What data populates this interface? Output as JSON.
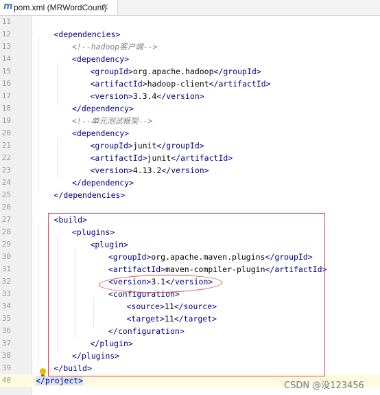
{
  "tab": {
    "icon": "m",
    "label": "pom.xml (MRWordCount)",
    "close": "×"
  },
  "lines": [
    {
      "n": "11",
      "indent": 0,
      "parts": []
    },
    {
      "n": "12",
      "indent": 1,
      "parts": [
        {
          "t": "tg",
          "v": "<dependencies>"
        }
      ]
    },
    {
      "n": "13",
      "indent": 2,
      "parts": [
        {
          "t": "cm",
          "v": "<!--hadoop客户端-->"
        }
      ]
    },
    {
      "n": "14",
      "indent": 2,
      "parts": [
        {
          "t": "tg",
          "v": "<dependency>"
        }
      ]
    },
    {
      "n": "15",
      "indent": 3,
      "parts": [
        {
          "t": "tg",
          "v": "<groupId>"
        },
        {
          "t": "tx",
          "v": "org.apache.hadoop"
        },
        {
          "t": "tg",
          "v": "</groupId>"
        }
      ]
    },
    {
      "n": "16",
      "indent": 3,
      "parts": [
        {
          "t": "tg",
          "v": "<artifactId>"
        },
        {
          "t": "tx",
          "v": "hadoop-client"
        },
        {
          "t": "tg",
          "v": "</artifactId>"
        }
      ]
    },
    {
      "n": "17",
      "indent": 3,
      "parts": [
        {
          "t": "tg",
          "v": "<version>"
        },
        {
          "t": "tx",
          "v": "3.3.4"
        },
        {
          "t": "tg",
          "v": "</version>"
        }
      ]
    },
    {
      "n": "18",
      "indent": 2,
      "parts": [
        {
          "t": "tg",
          "v": "</dependency>"
        }
      ]
    },
    {
      "n": "19",
      "indent": 2,
      "parts": [
        {
          "t": "cm",
          "v": "<!--单元测试框架-->"
        }
      ]
    },
    {
      "n": "20",
      "indent": 2,
      "parts": [
        {
          "t": "tg",
          "v": "<dependency>"
        }
      ]
    },
    {
      "n": "21",
      "indent": 3,
      "parts": [
        {
          "t": "tg",
          "v": "<groupId>"
        },
        {
          "t": "tx",
          "v": "junit"
        },
        {
          "t": "tg",
          "v": "</groupId>"
        }
      ]
    },
    {
      "n": "22",
      "indent": 3,
      "parts": [
        {
          "t": "tg",
          "v": "<artifactId>"
        },
        {
          "t": "tx",
          "v": "junit"
        },
        {
          "t": "tg",
          "v": "</artifactId>"
        }
      ]
    },
    {
      "n": "23",
      "indent": 3,
      "parts": [
        {
          "t": "tg",
          "v": "<version>"
        },
        {
          "t": "tx",
          "v": "4.13.2"
        },
        {
          "t": "tg",
          "v": "</version>"
        }
      ]
    },
    {
      "n": "24",
      "indent": 2,
      "parts": [
        {
          "t": "tg",
          "v": "</dependency>"
        }
      ]
    },
    {
      "n": "25",
      "indent": 1,
      "parts": [
        {
          "t": "tg",
          "v": "</dependencies>"
        }
      ]
    },
    {
      "n": "26",
      "indent": 0,
      "parts": []
    },
    {
      "n": "27",
      "indent": 1,
      "parts": [
        {
          "t": "tg",
          "v": "<build>"
        }
      ]
    },
    {
      "n": "28",
      "indent": 2,
      "parts": [
        {
          "t": "tg",
          "v": "<plugins>"
        }
      ]
    },
    {
      "n": "29",
      "indent": 3,
      "parts": [
        {
          "t": "tg",
          "v": "<plugin>"
        }
      ]
    },
    {
      "n": "30",
      "indent": 4,
      "parts": [
        {
          "t": "tg",
          "v": "<groupId>"
        },
        {
          "t": "tx",
          "v": "org.apache.maven.plugins"
        },
        {
          "t": "tg",
          "v": "</groupId>"
        }
      ]
    },
    {
      "n": "31",
      "indent": 4,
      "parts": [
        {
          "t": "tg",
          "v": "<artifactId>"
        },
        {
          "t": "tx",
          "v": "maven-compiler-plugin"
        },
        {
          "t": "tg",
          "v": "</artifactId>"
        }
      ]
    },
    {
      "n": "32",
      "indent": 4,
      "parts": [
        {
          "t": "tg",
          "v": "<version>"
        },
        {
          "t": "tx",
          "v": "3.1"
        },
        {
          "t": "tg",
          "v": "</version>"
        }
      ]
    },
    {
      "n": "33",
      "indent": 4,
      "parts": [
        {
          "t": "tg",
          "v": "<configuration>"
        }
      ]
    },
    {
      "n": "34",
      "indent": 5,
      "parts": [
        {
          "t": "tg",
          "v": "<source>"
        },
        {
          "t": "tx",
          "v": "11"
        },
        {
          "t": "tg",
          "v": "</source>"
        }
      ]
    },
    {
      "n": "35",
      "indent": 5,
      "parts": [
        {
          "t": "tg",
          "v": "<target>"
        },
        {
          "t": "tx",
          "v": "11"
        },
        {
          "t": "tg",
          "v": "</target>"
        }
      ]
    },
    {
      "n": "36",
      "indent": 4,
      "parts": [
        {
          "t": "tg",
          "v": "</configuration>"
        }
      ]
    },
    {
      "n": "37",
      "indent": 3,
      "parts": [
        {
          "t": "tg",
          "v": "</plugin>"
        }
      ]
    },
    {
      "n": "38",
      "indent": 2,
      "parts": [
        {
          "t": "tg",
          "v": "</plugins>"
        }
      ]
    },
    {
      "n": "39",
      "indent": 1,
      "parts": [
        {
          "t": "tg",
          "v": "</build>"
        }
      ]
    },
    {
      "n": "40",
      "indent": 0,
      "parts": [
        {
          "t": "tg cursor-tag",
          "v": "</project>"
        }
      ]
    }
  ],
  "watermark": "CSDN @没123456",
  "colors": {
    "tag": "#000080",
    "comment": "#808080",
    "highlight": "#e0474c",
    "gutter": "#f0f0f0"
  }
}
